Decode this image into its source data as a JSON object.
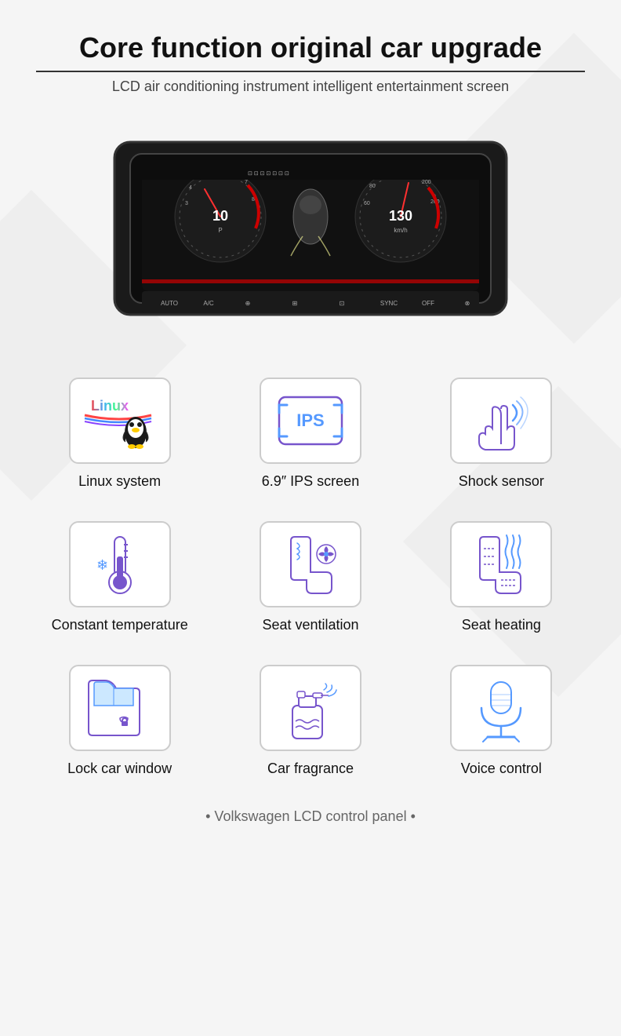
{
  "header": {
    "title": "Core function original car upgrade",
    "subtitle": "LCD air conditioning instrument intelligent entertainment screen"
  },
  "features_row1": [
    {
      "id": "linux-system",
      "label": "Linux system",
      "icon_type": "linux"
    },
    {
      "id": "ips-screen",
      "label": "6.9″   IPS screen",
      "icon_type": "ips"
    },
    {
      "id": "shock-sensor",
      "label": "Shock sensor",
      "icon_type": "shock"
    }
  ],
  "features_row2": [
    {
      "id": "constant-temperature",
      "label": "Constant temperature",
      "icon_type": "temp"
    },
    {
      "id": "seat-ventilation",
      "label": "Seat ventilation",
      "icon_type": "ventilation"
    },
    {
      "id": "seat-heating",
      "label": "Seat heating",
      "icon_type": "heating"
    }
  ],
  "features_row3": [
    {
      "id": "lock-car-window",
      "label": "Lock car window",
      "icon_type": "window"
    },
    {
      "id": "car-fragrance",
      "label": "Car fragrance",
      "icon_type": "fragrance"
    },
    {
      "id": "voice-control",
      "label": "Voice control",
      "icon_type": "voice"
    }
  ],
  "footer": {
    "text": "• Volkswagen LCD control panel •"
  }
}
